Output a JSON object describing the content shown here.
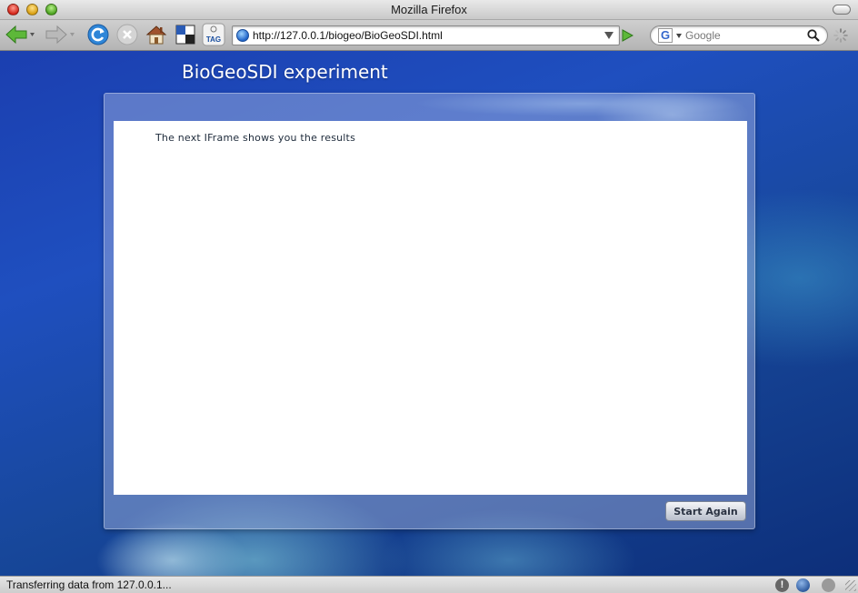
{
  "window": {
    "title": "Mozilla Firefox"
  },
  "toolbar": {
    "url": "http://127.0.0.1/biogeo/BioGeoSDI.html",
    "search_engine_letter": "G",
    "search_placeholder": "Google",
    "tag_label": "TAG"
  },
  "page": {
    "heading": "BioGeoSDI experiment",
    "iframe_text": "The next IFrame shows you the results",
    "start_again_label": "Start Again"
  },
  "statusbar": {
    "text": "Transferring data from 127.0.0.1...",
    "warn_glyph": "!"
  },
  "colors": {
    "ocean": "#1f4fbf",
    "panel": "#aab9e1",
    "button_text": "#2a3242"
  },
  "icons": [
    "back-arrow-icon",
    "forward-arrow-icon",
    "reload-icon",
    "stop-icon",
    "home-icon",
    "bookmark-icon",
    "tag-icon",
    "globe-icon",
    "go-arrow-icon",
    "search-icon",
    "throbber-icon",
    "warning-icon",
    "mozilla-icon",
    "blocked-icon",
    "resize-grip-icon"
  ]
}
